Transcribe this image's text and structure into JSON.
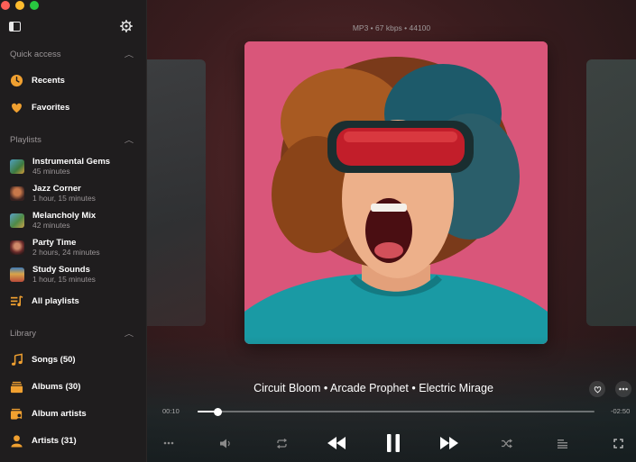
{
  "sidebar": {
    "quick_access": {
      "title": "Quick access",
      "items": [
        {
          "label": "Recents",
          "icon": "clock-icon"
        },
        {
          "label": "Favorites",
          "icon": "heart-icon"
        }
      ]
    },
    "playlists": {
      "title": "Playlists",
      "items": [
        {
          "title": "Instrumental Gems",
          "subtitle": "45 minutes"
        },
        {
          "title": "Jazz Corner",
          "subtitle": "1 hour, 15 minutes"
        },
        {
          "title": "Melancholy Mix",
          "subtitle": "42 minutes"
        },
        {
          "title": "Party Time",
          "subtitle": "2 hours, 24 minutes"
        },
        {
          "title": "Study Sounds",
          "subtitle": "1 hour, 15 minutes"
        }
      ],
      "all_label": "All playlists"
    },
    "library": {
      "title": "Library",
      "items": [
        {
          "label": "Songs (50)",
          "icon": "music-note-icon"
        },
        {
          "label": "Albums (30)",
          "icon": "album-icon"
        },
        {
          "label": "Album artists",
          "icon": "album-artist-icon"
        },
        {
          "label": "Artists (31)",
          "icon": "person-icon"
        }
      ]
    }
  },
  "player": {
    "format_info": "MP3 • 67 kbps • 44100",
    "now_playing": "Circuit Bloom • Arcade Prophet • Electric Mirage",
    "time_elapsed": "00:10",
    "time_remaining": "-02:50",
    "progress": 0.05
  },
  "colors": {
    "accent": "#f0a030",
    "sidebar_bg": "#1f1d1e",
    "artwork_bg": "#d9567a"
  }
}
